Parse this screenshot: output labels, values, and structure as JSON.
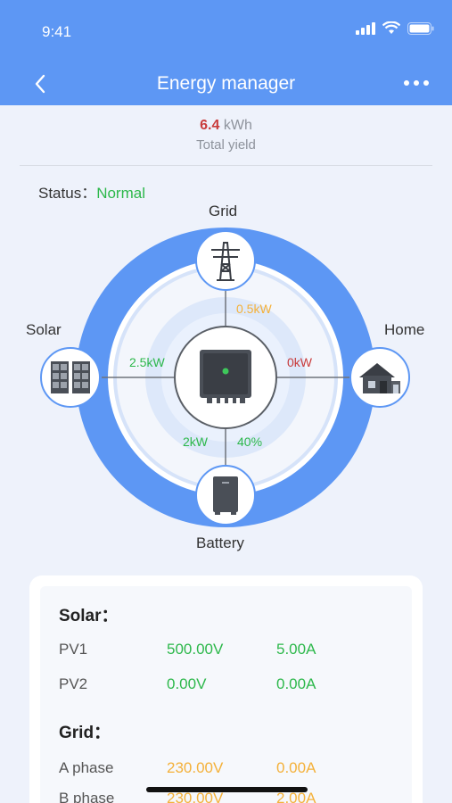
{
  "status_bar": {
    "time": "9:41"
  },
  "nav": {
    "title": "Energy manager"
  },
  "yield": {
    "value": "6.4",
    "unit": "kWh",
    "label": "Total yield"
  },
  "status": {
    "label": "Status：",
    "value": "Normal"
  },
  "flow": {
    "grid_label": "Grid",
    "solar_label": "Solar",
    "home_label": "Home",
    "battery_label": "Battery",
    "grid_power": "0.5kW",
    "solar_power": "2.5kW",
    "home_power": "0kW",
    "battery_power": "2kW",
    "battery_soc": "40%"
  },
  "details": {
    "solar_title": "Solar：",
    "solar_rows": [
      {
        "label": "PV1",
        "voltage": "500.00V",
        "current": "5.00A"
      },
      {
        "label": "PV2",
        "voltage": "0.00V",
        "current": "0.00A"
      }
    ],
    "grid_title": "Grid：",
    "grid_rows": [
      {
        "label": "A phase",
        "voltage": "230.00V",
        "current": "0.00A"
      },
      {
        "label": "B phase",
        "voltage": "230.00V",
        "current": "2.00A"
      }
    ]
  },
  "colors": {
    "accent": "#5d97f4",
    "green": "#2db84b",
    "orange": "#f4b13a",
    "red": "#c93b3b"
  }
}
